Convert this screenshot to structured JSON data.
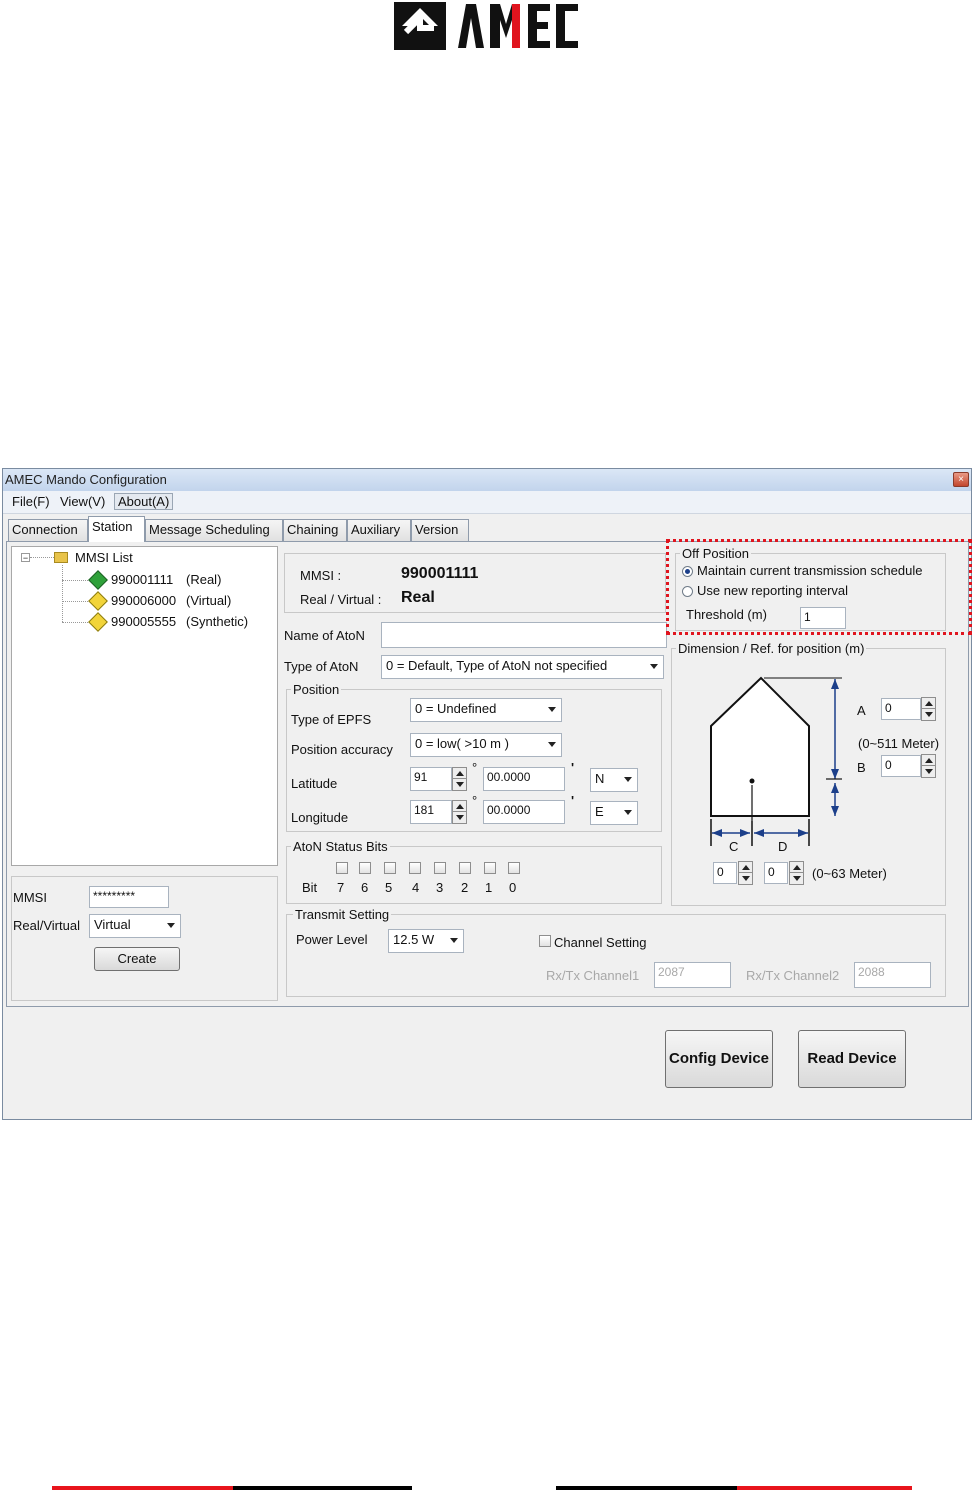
{
  "window": {
    "title": "AMEC Mando Configuration",
    "close_glyph": "×"
  },
  "menu": [
    "File(F)",
    "View(V)",
    "About(A)"
  ],
  "tabs": [
    "Connection",
    "Station",
    "Message Scheduling",
    "Chaining",
    "Auxiliary",
    "Version"
  ],
  "tree": {
    "root": "MMSI List",
    "items": [
      {
        "mmsi": "990001111",
        "type": "(Real)",
        "icon": "green-diamond-icon"
      },
      {
        "mmsi": "990006000",
        "type": "(Virtual)",
        "icon": "yellow-diamond-icon"
      },
      {
        "mmsi": "990005555",
        "type": "(Synthetic)",
        "icon": "yellow-diamond-icon"
      }
    ]
  },
  "create_panel": {
    "mmsi_label": "MMSI",
    "mmsi_value": "*********",
    "rv_label": "Real/Virtual",
    "rv_value": "Virtual",
    "create_label": "Create"
  },
  "info": {
    "mmsi_label": "MMSI :",
    "mmsi_value": "990001111",
    "rv_label": "Real / Virtual :",
    "rv_value": "Real"
  },
  "name_of_aton": {
    "label": "Name of AtoN",
    "value": ""
  },
  "type_of_aton": {
    "label": "Type of AtoN",
    "value": "0 = Default, Type of AtoN not specified"
  },
  "position": {
    "title": "Position",
    "epfs_label": "Type of EPFS",
    "epfs_value": "0 = Undefined",
    "accuracy_label": "Position accuracy",
    "accuracy_value": "0 = low( >10 m )",
    "lat_label": "Latitude",
    "lat_deg": "91",
    "lat_min": "00.0000",
    "lat_dir": "N",
    "lon_label": "Longitude",
    "lon_deg": "181",
    "lon_min": "00.0000",
    "lon_dir": "E",
    "deg_symbol": "°",
    "min_symbol": "'"
  },
  "status_bits": {
    "title": "AtoN Status Bits",
    "bit_label": "Bit",
    "bits": [
      "7",
      "6",
      "5",
      "4",
      "3",
      "2",
      "1",
      "0"
    ]
  },
  "off_position": {
    "title": "Off Position",
    "opt1": "Maintain current transmission schedule",
    "opt2": "Use new reporting interval",
    "selected": "opt1",
    "threshold_label": "Threshold (m)",
    "threshold_value": "1"
  },
  "dimension": {
    "title": "Dimension / Ref. for position (m)",
    "a_label": "A",
    "a_value": "0",
    "ab_range": "(0~511 Meter)",
    "b_label": "B",
    "b_value": "0",
    "c_label": "C",
    "c_value": "0",
    "d_label": "D",
    "d_value": "0",
    "cd_range": "(0~63 Meter)"
  },
  "transmit": {
    "title": "Transmit Setting",
    "power_label": "Power Level",
    "power_value": "12.5 W",
    "channel_setting": "Channel Setting",
    "ch1_label": "Rx/Tx Channel1",
    "ch1_value": "2087",
    "ch2_label": "Rx/Tx Channel2",
    "ch2_value": "2088"
  },
  "buttons": {
    "config": "Config Device",
    "read": "Read Device"
  },
  "colors": {
    "highlight": "#e0141e",
    "footer_red": "#e8141c",
    "footer_black": "#000000"
  }
}
